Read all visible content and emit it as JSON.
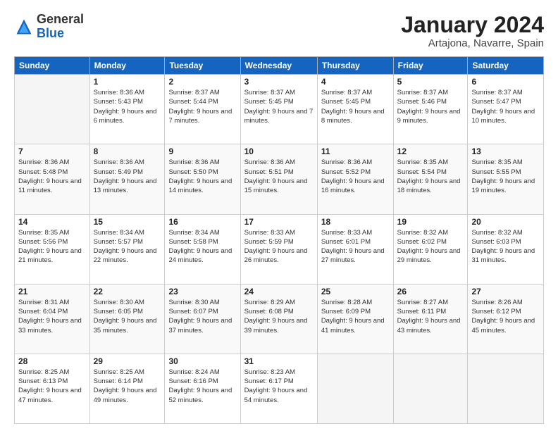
{
  "logo": {
    "general": "General",
    "blue": "Blue"
  },
  "header": {
    "title": "January 2024",
    "location": "Artajona, Navarre, Spain"
  },
  "weekdays": [
    "Sunday",
    "Monday",
    "Tuesday",
    "Wednesday",
    "Thursday",
    "Friday",
    "Saturday"
  ],
  "weeks": [
    [
      {
        "day": "",
        "sunrise": "",
        "sunset": "",
        "daylight": ""
      },
      {
        "day": "1",
        "sunrise": "Sunrise: 8:36 AM",
        "sunset": "Sunset: 5:43 PM",
        "daylight": "Daylight: 9 hours and 6 minutes."
      },
      {
        "day": "2",
        "sunrise": "Sunrise: 8:37 AM",
        "sunset": "Sunset: 5:44 PM",
        "daylight": "Daylight: 9 hours and 7 minutes."
      },
      {
        "day": "3",
        "sunrise": "Sunrise: 8:37 AM",
        "sunset": "Sunset: 5:45 PM",
        "daylight": "Daylight: 9 hours and 7 minutes."
      },
      {
        "day": "4",
        "sunrise": "Sunrise: 8:37 AM",
        "sunset": "Sunset: 5:45 PM",
        "daylight": "Daylight: 9 hours and 8 minutes."
      },
      {
        "day": "5",
        "sunrise": "Sunrise: 8:37 AM",
        "sunset": "Sunset: 5:46 PM",
        "daylight": "Daylight: 9 hours and 9 minutes."
      },
      {
        "day": "6",
        "sunrise": "Sunrise: 8:37 AM",
        "sunset": "Sunset: 5:47 PM",
        "daylight": "Daylight: 9 hours and 10 minutes."
      }
    ],
    [
      {
        "day": "7",
        "sunrise": "Sunrise: 8:36 AM",
        "sunset": "Sunset: 5:48 PM",
        "daylight": "Daylight: 9 hours and 11 minutes."
      },
      {
        "day": "8",
        "sunrise": "Sunrise: 8:36 AM",
        "sunset": "Sunset: 5:49 PM",
        "daylight": "Daylight: 9 hours and 13 minutes."
      },
      {
        "day": "9",
        "sunrise": "Sunrise: 8:36 AM",
        "sunset": "Sunset: 5:50 PM",
        "daylight": "Daylight: 9 hours and 14 minutes."
      },
      {
        "day": "10",
        "sunrise": "Sunrise: 8:36 AM",
        "sunset": "Sunset: 5:51 PM",
        "daylight": "Daylight: 9 hours and 15 minutes."
      },
      {
        "day": "11",
        "sunrise": "Sunrise: 8:36 AM",
        "sunset": "Sunset: 5:52 PM",
        "daylight": "Daylight: 9 hours and 16 minutes."
      },
      {
        "day": "12",
        "sunrise": "Sunrise: 8:35 AM",
        "sunset": "Sunset: 5:54 PM",
        "daylight": "Daylight: 9 hours and 18 minutes."
      },
      {
        "day": "13",
        "sunrise": "Sunrise: 8:35 AM",
        "sunset": "Sunset: 5:55 PM",
        "daylight": "Daylight: 9 hours and 19 minutes."
      }
    ],
    [
      {
        "day": "14",
        "sunrise": "Sunrise: 8:35 AM",
        "sunset": "Sunset: 5:56 PM",
        "daylight": "Daylight: 9 hours and 21 minutes."
      },
      {
        "day": "15",
        "sunrise": "Sunrise: 8:34 AM",
        "sunset": "Sunset: 5:57 PM",
        "daylight": "Daylight: 9 hours and 22 minutes."
      },
      {
        "day": "16",
        "sunrise": "Sunrise: 8:34 AM",
        "sunset": "Sunset: 5:58 PM",
        "daylight": "Daylight: 9 hours and 24 minutes."
      },
      {
        "day": "17",
        "sunrise": "Sunrise: 8:33 AM",
        "sunset": "Sunset: 5:59 PM",
        "daylight": "Daylight: 9 hours and 26 minutes."
      },
      {
        "day": "18",
        "sunrise": "Sunrise: 8:33 AM",
        "sunset": "Sunset: 6:01 PM",
        "daylight": "Daylight: 9 hours and 27 minutes."
      },
      {
        "day": "19",
        "sunrise": "Sunrise: 8:32 AM",
        "sunset": "Sunset: 6:02 PM",
        "daylight": "Daylight: 9 hours and 29 minutes."
      },
      {
        "day": "20",
        "sunrise": "Sunrise: 8:32 AM",
        "sunset": "Sunset: 6:03 PM",
        "daylight": "Daylight: 9 hours and 31 minutes."
      }
    ],
    [
      {
        "day": "21",
        "sunrise": "Sunrise: 8:31 AM",
        "sunset": "Sunset: 6:04 PM",
        "daylight": "Daylight: 9 hours and 33 minutes."
      },
      {
        "day": "22",
        "sunrise": "Sunrise: 8:30 AM",
        "sunset": "Sunset: 6:05 PM",
        "daylight": "Daylight: 9 hours and 35 minutes."
      },
      {
        "day": "23",
        "sunrise": "Sunrise: 8:30 AM",
        "sunset": "Sunset: 6:07 PM",
        "daylight": "Daylight: 9 hours and 37 minutes."
      },
      {
        "day": "24",
        "sunrise": "Sunrise: 8:29 AM",
        "sunset": "Sunset: 6:08 PM",
        "daylight": "Daylight: 9 hours and 39 minutes."
      },
      {
        "day": "25",
        "sunrise": "Sunrise: 8:28 AM",
        "sunset": "Sunset: 6:09 PM",
        "daylight": "Daylight: 9 hours and 41 minutes."
      },
      {
        "day": "26",
        "sunrise": "Sunrise: 8:27 AM",
        "sunset": "Sunset: 6:11 PM",
        "daylight": "Daylight: 9 hours and 43 minutes."
      },
      {
        "day": "27",
        "sunrise": "Sunrise: 8:26 AM",
        "sunset": "Sunset: 6:12 PM",
        "daylight": "Daylight: 9 hours and 45 minutes."
      }
    ],
    [
      {
        "day": "28",
        "sunrise": "Sunrise: 8:25 AM",
        "sunset": "Sunset: 6:13 PM",
        "daylight": "Daylight: 9 hours and 47 minutes."
      },
      {
        "day": "29",
        "sunrise": "Sunrise: 8:25 AM",
        "sunset": "Sunset: 6:14 PM",
        "daylight": "Daylight: 9 hours and 49 minutes."
      },
      {
        "day": "30",
        "sunrise": "Sunrise: 8:24 AM",
        "sunset": "Sunset: 6:16 PM",
        "daylight": "Daylight: 9 hours and 52 minutes."
      },
      {
        "day": "31",
        "sunrise": "Sunrise: 8:23 AM",
        "sunset": "Sunset: 6:17 PM",
        "daylight": "Daylight: 9 hours and 54 minutes."
      },
      {
        "day": "",
        "sunrise": "",
        "sunset": "",
        "daylight": ""
      },
      {
        "day": "",
        "sunrise": "",
        "sunset": "",
        "daylight": ""
      },
      {
        "day": "",
        "sunrise": "",
        "sunset": "",
        "daylight": ""
      }
    ]
  ]
}
